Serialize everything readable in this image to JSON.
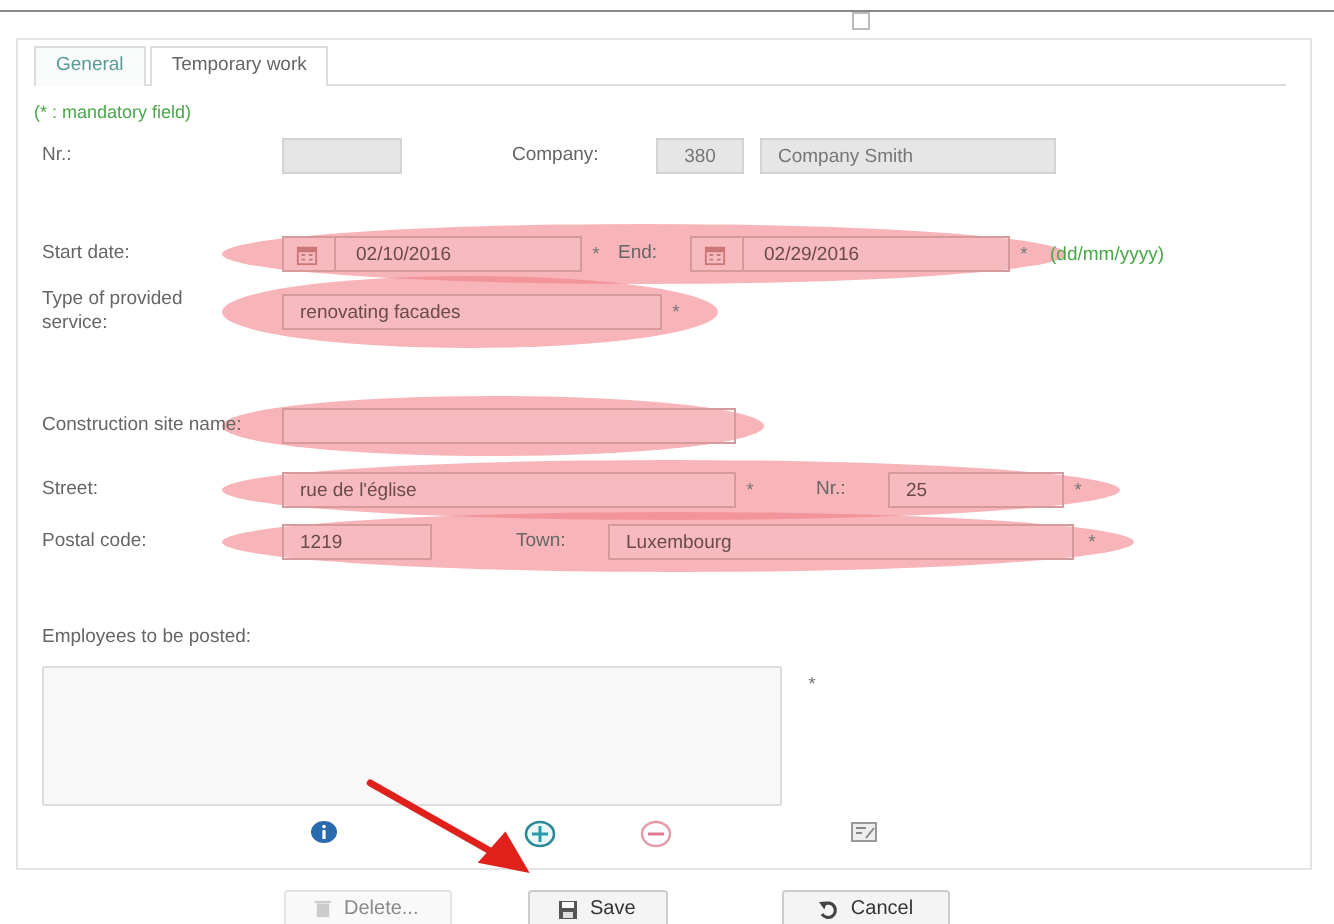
{
  "tabs": [
    {
      "label": "General",
      "selected": true
    },
    {
      "label": "Temporary work",
      "selected": false
    }
  ],
  "mandatory_note": "(* : mandatory field)",
  "rows": [
    {
      "highlighted": false,
      "items": [
        {
          "kind": "label",
          "text": "Nr.:"
        },
        {
          "kind": "field",
          "disabled": true
        },
        {
          "kind": "label",
          "text": "Company:"
        },
        {
          "kind": "field",
          "value": "380",
          "disabled": true
        },
        {
          "kind": "field",
          "value": "Company Smith",
          "disabled": true
        }
      ]
    },
    {
      "highlighted": true,
      "items": [
        {
          "kind": "label",
          "text": "Start date:"
        },
        {
          "kind": "date",
          "value": "02/10/2016",
          "disabled": false
        },
        {
          "kind": "required",
          "text": "*"
        },
        {
          "kind": "label",
          "text": "End:"
        },
        {
          "kind": "date",
          "value": "02/29/2016",
          "disabled": false
        },
        {
          "kind": "required",
          "text": "*"
        },
        {
          "kind": "hint",
          "text": "(dd/mm/yyyy)"
        }
      ]
    },
    {
      "highlighted": true,
      "items": [
        {
          "kind": "label",
          "text": "Type of provided service:"
        },
        {
          "kind": "field",
          "value": "renovating facades",
          "disabled": false
        },
        {
          "kind": "required",
          "text": "*"
        }
      ]
    },
    {
      "highlighted": true,
      "items": [
        {
          "kind": "label",
          "text": "Construction site name:"
        },
        {
          "kind": "field",
          "disabled": false
        }
      ]
    },
    {
      "highlighted": true,
      "items": [
        {
          "kind": "label",
          "text": "Street:"
        },
        {
          "kind": "field",
          "value": "rue de l'église",
          "disabled": false
        },
        {
          "kind": "required",
          "text": "*"
        },
        {
          "kind": "label",
          "text": "Nr.:"
        },
        {
          "kind": "field",
          "value": "25",
          "disabled": false
        },
        {
          "kind": "required",
          "text": "*"
        }
      ]
    },
    {
      "highlighted": true,
      "items": [
        {
          "kind": "label",
          "text": "Postal code:"
        },
        {
          "kind": "field",
          "value": "1219",
          "disabled": false
        },
        {
          "kind": "label",
          "text": "Town:"
        },
        {
          "kind": "field",
          "value": "Luxembourg",
          "disabled": false
        },
        {
          "kind": "required",
          "text": "*"
        }
      ]
    }
  ],
  "employees": {
    "label": "Employees to be posted:",
    "required": "*",
    "tools": [
      {
        "kind": "info"
      },
      {
        "kind": "add"
      },
      {
        "kind": "remove"
      },
      {
        "kind": "edit"
      }
    ]
  },
  "buttons": [
    {
      "label": "Delete...",
      "kind": "delete",
      "disabled": true
    },
    {
      "label": "Save",
      "kind": "save",
      "disabled": false
    },
    {
      "label": "Cancel",
      "kind": "cancel",
      "disabled": false
    }
  ]
}
